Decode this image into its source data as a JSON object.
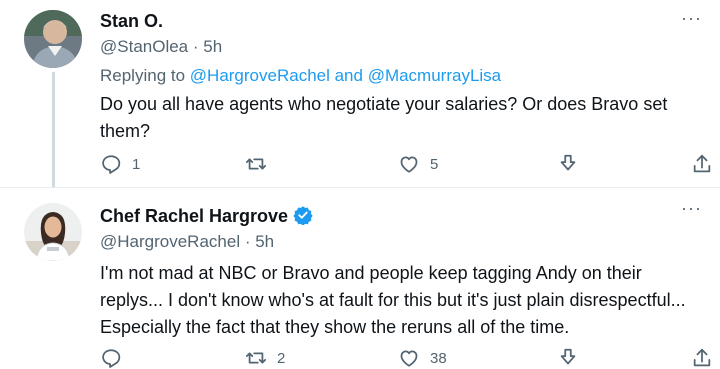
{
  "colors": {
    "link": "#1d9bf0",
    "secondary_text": "#536471",
    "primary_text": "#0f1419",
    "verified_badge": "#1d9bf0"
  },
  "tweets": [
    {
      "display_name": "Stan O.",
      "verified": false,
      "handle": "@StanOlea",
      "separator": " · ",
      "time": "5h",
      "more": "···",
      "reply_prefix": "Replying to ",
      "reply_user_1": "@HargroveRachel",
      "reply_and": " and ",
      "reply_user_2": "@MacmurrayLisa",
      "text_lines": [
        "Do you all have agents who negotiate your salaries? Or does Bravo set",
        "them?"
      ],
      "actions": {
        "reply_icon": "reply-icon",
        "reply_count": "1",
        "retweet_icon": "retweet-icon",
        "retweet_count": "",
        "like_icon": "heart-icon",
        "like_count": "5",
        "download_icon": "download-icon",
        "share_icon": "share-icon"
      }
    },
    {
      "display_name": "Chef Rachel Hargrove",
      "verified": true,
      "handle": "@HargroveRachel",
      "separator": " · ",
      "time": "5h",
      "more": "···",
      "text_lines": [
        "I'm not mad at NBC or Bravo and people keep tagging Andy on their",
        "replys... I don't know who's at fault for this but it's just plain disrespectful...",
        "Especially the fact that they show the reruns all of the time."
      ],
      "actions": {
        "reply_icon": "reply-icon",
        "reply_count": "",
        "retweet_icon": "retweet-icon",
        "retweet_count": "2",
        "like_icon": "heart-icon",
        "like_count": "38",
        "download_icon": "download-icon",
        "share_icon": "share-icon"
      }
    }
  ]
}
